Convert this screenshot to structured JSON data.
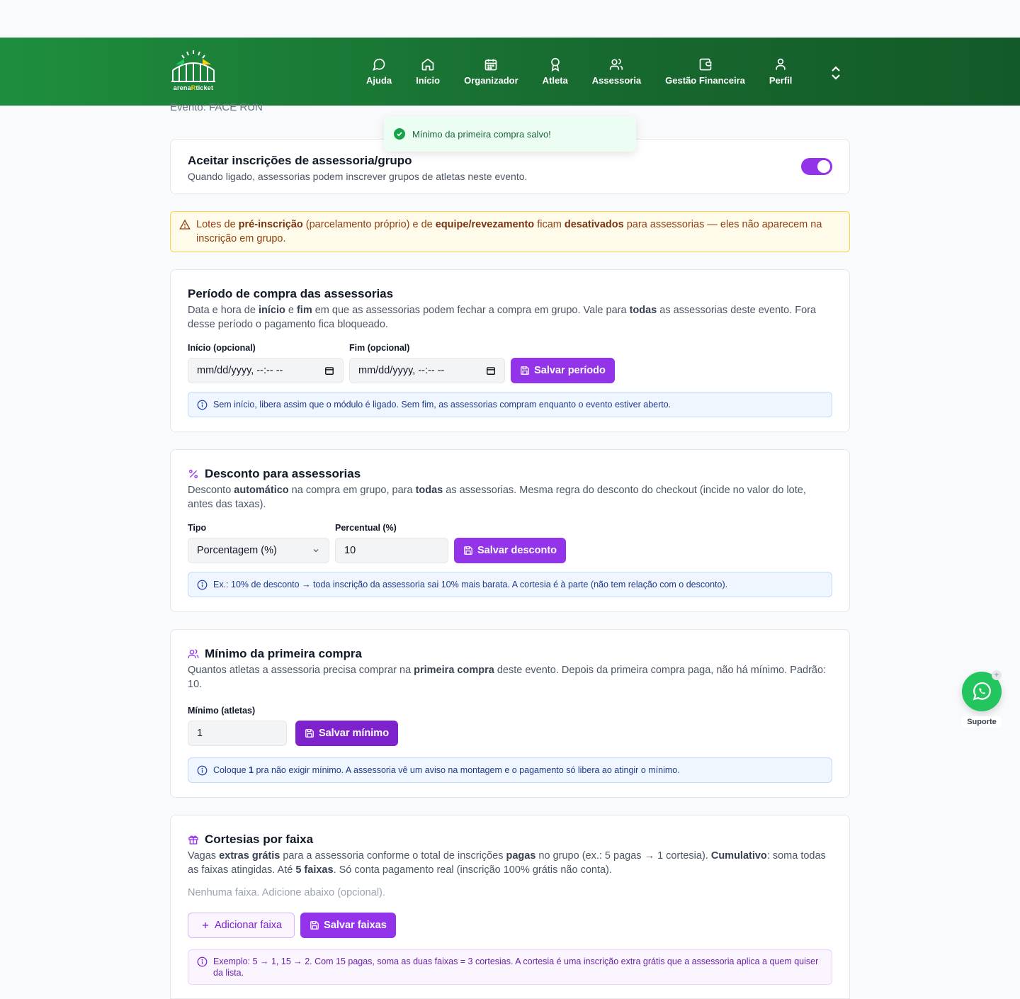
{
  "nav": {
    "logo_text_a": "arena",
    "logo_text_b": "R",
    "logo_text_c": "ticket",
    "items": [
      {
        "label": "Ajuda",
        "icon": "chat-bubble-icon"
      },
      {
        "label": "Início",
        "icon": "home-icon"
      },
      {
        "label": "Organizador",
        "icon": "calendar-icon"
      },
      {
        "label": "Atleta",
        "icon": "medal-icon"
      },
      {
        "label": "Assessoria",
        "icon": "users-icon"
      },
      {
        "label": "Gestão Financeira",
        "icon": "wallet-icon"
      },
      {
        "label": "Perfil",
        "icon": "user-icon"
      }
    ]
  },
  "evento": "Evento: FACE RUN",
  "toast": {
    "message": "Mínimo da primeira compra salvo!"
  },
  "accept": {
    "title": "Aceitar inscrições de assessoria/grupo",
    "desc": "Quando ligado, assessorias podem inscrever grupos de atletas neste evento.",
    "enabled": true
  },
  "warning": {
    "t1": "Lotes de ",
    "b1": "pré-inscrição",
    "t2": " (parcelamento próprio) e de ",
    "b2": "equipe/revezamento",
    "t3": " ficam ",
    "b3": "desativados",
    "t4": " para assessorias — eles não aparecem na inscrição em grupo."
  },
  "periodo": {
    "title": "Período de compra das assessorias",
    "d1": "Data e hora de ",
    "b1": "início",
    "d2": " e ",
    "b2": "fim",
    "d3": " em que as assessorias podem fechar a compra em grupo. Vale para ",
    "b3": "todas",
    "d4": " as assessorias deste evento. Fora desse período o pagamento fica bloqueado.",
    "inicio_label": "Início (opcional)",
    "inicio_value": "mm/dd/yyyy, --:-- --",
    "fim_label": "Fim (opcional)",
    "fim_value": "mm/dd/yyyy, --:-- --",
    "save": "Salvar período",
    "info": "Sem início, libera assim que o módulo é ligado. Sem fim, as assessorias compram enquanto o evento estiver aberto."
  },
  "desconto": {
    "title": "Desconto para assessorias",
    "d1": "Desconto ",
    "b1": "automático",
    "d2": " na compra em grupo, para ",
    "b2": "todas",
    "d3": " as assessorias. Mesma regra do desconto do checkout (incide no valor do lote, antes das taxas).",
    "tipo_label": "Tipo",
    "tipo_value": "Porcentagem (%)",
    "perc_label": "Percentual (%)",
    "perc_value": "10",
    "save": "Salvar desconto",
    "info": "Ex.: 10% de desconto → toda inscrição da assessoria sai 10% mais barata. A cortesia é à parte (não tem relação com o desconto)."
  },
  "minimo": {
    "title": "Mínimo da primeira compra",
    "d1": "Quantos atletas a assessoria precisa comprar na ",
    "b1": "primeira compra",
    "d2": " deste evento. Depois da primeira compra paga, não há mínimo. Padrão: 10.",
    "label": "Mínimo (atletas)",
    "value": "1",
    "save": "Salvar mínimo",
    "info1": "Coloque ",
    "info_b": "1",
    "info2": " pra não exigir mínimo. A assessoria vê um aviso na montagem e o pagamento só libera ao atingir o mínimo."
  },
  "cortesias": {
    "title": "Cortesias por faixa",
    "d1": "Vagas ",
    "b1": "extras grátis",
    "d2": " para a assessoria conforme o total de inscrições ",
    "b2": "pagas",
    "d3": " no grupo (ex.: 5 pagas → 1 cortesia). ",
    "b3": "Cumulativo",
    "d4": ": soma todas as faixas atingidas. Até ",
    "b4": "5 faixas",
    "d5": ". Só conta pagamento real (inscrição 100% grátis não conta).",
    "empty": "Nenhuma faixa. Adicione abaixo (opcional).",
    "add": "Adicionar faixa",
    "save": "Salvar faixas",
    "info": "Exemplo: 5 → 1, 15 → 2. Com 15 pagas, soma as duas faixas = 3 cortesias. A cortesia é uma inscrição extra grátis que a assessoria aplica a quem quiser da lista."
  },
  "support": {
    "label": "Suporte"
  },
  "colors": {
    "primary": "#9333ea",
    "nav_green": "#1e8e3e",
    "whatsapp": "#22c55e"
  }
}
